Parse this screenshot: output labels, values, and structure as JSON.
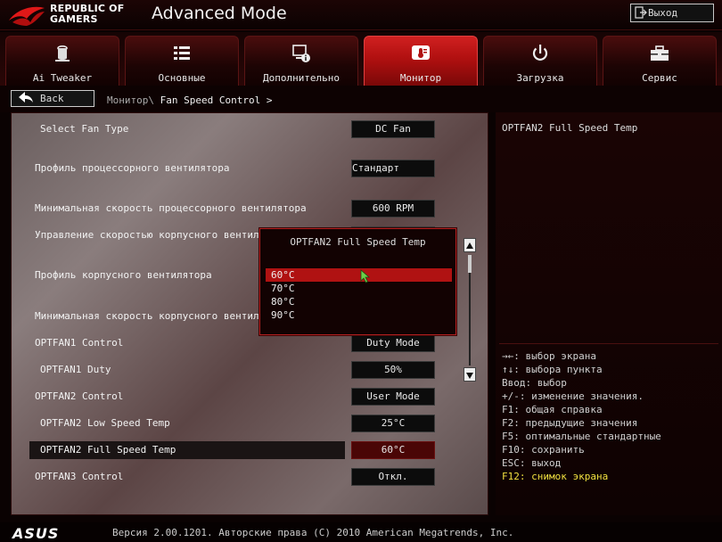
{
  "header": {
    "brand_line1": "REPUBLIC OF",
    "brand_line2": "GAMERS",
    "title": "Advanced Mode",
    "exit_label": "Выход"
  },
  "tabs": [
    {
      "label": "Ai Tweaker",
      "icon": "tweaker-icon",
      "active": false
    },
    {
      "label": "Основные",
      "icon": "list-icon",
      "active": false
    },
    {
      "label": "Дополнительно",
      "icon": "advanced-icon",
      "active": false
    },
    {
      "label": "Монитор",
      "icon": "thermometer-icon",
      "active": true
    },
    {
      "label": "Загрузка",
      "icon": "power-icon",
      "active": false
    },
    {
      "label": "Сервис",
      "icon": "toolbox-icon",
      "active": false
    }
  ],
  "nav": {
    "back_label": "Back",
    "breadcrumb_parent": "Монитор\\",
    "breadcrumb_current": "Fan Speed Control >"
  },
  "settings": [
    {
      "label": "Select Fan Type",
      "value": "DC Fan",
      "indent": true
    },
    {
      "label": "Профиль процессорного вентилятора",
      "value": "Стандарт",
      "indent": false
    },
    {
      "label": "Минимальная скорость процессорного вентилятора",
      "value": "600 RPM",
      "indent": false
    },
    {
      "label": "Управление скоростью корпусного вентилятора",
      "value": "",
      "indent": false
    },
    {
      "label": "Профиль корпусного вентилятора",
      "value": "",
      "indent": false
    },
    {
      "label": "Минимальная скорость корпусного вентилятора",
      "value": "",
      "indent": false
    },
    {
      "label": "OPTFAN1 Control",
      "value": "Duty Mode",
      "indent": false
    },
    {
      "label": "OPTFAN1 Duty",
      "value": "50%",
      "indent": true
    },
    {
      "label": "OPTFAN2 Control",
      "value": "User Mode",
      "indent": false
    },
    {
      "label": "OPTFAN2 Low Speed Temp",
      "value": "25°C",
      "indent": true
    },
    {
      "label": "OPTFAN2 Full Speed Temp",
      "value": "60°C",
      "indent": true,
      "selected": true
    },
    {
      "label": "OPTFAN3 Control",
      "value": "Откл.",
      "indent": false
    }
  ],
  "popup": {
    "title": "OPTFAN2 Full Speed Temp",
    "options": [
      "60°C",
      "70°C",
      "80°C",
      "90°C"
    ],
    "selected_index": 0
  },
  "help": {
    "title": "OPTFAN2 Full Speed Temp",
    "keys": [
      "→←: выбор экрана",
      "↑↓: выбора пункта",
      "Ввод: выбор",
      "+/-: изменение значения.",
      "F1: общая справка",
      "F2: предыдущие значения",
      "F5: оптимальные стандартные",
      "F10: сохранить",
      "ESC: выход",
      "F12: снимок экрана"
    ]
  },
  "footer": {
    "logo": "ASUS",
    "version": "Версия 2.00.1201. Авторские права (C) 2010 American Megatrends, Inc."
  },
  "colors": {
    "accent": "#b01212",
    "help_highlight": "#f0e040"
  }
}
